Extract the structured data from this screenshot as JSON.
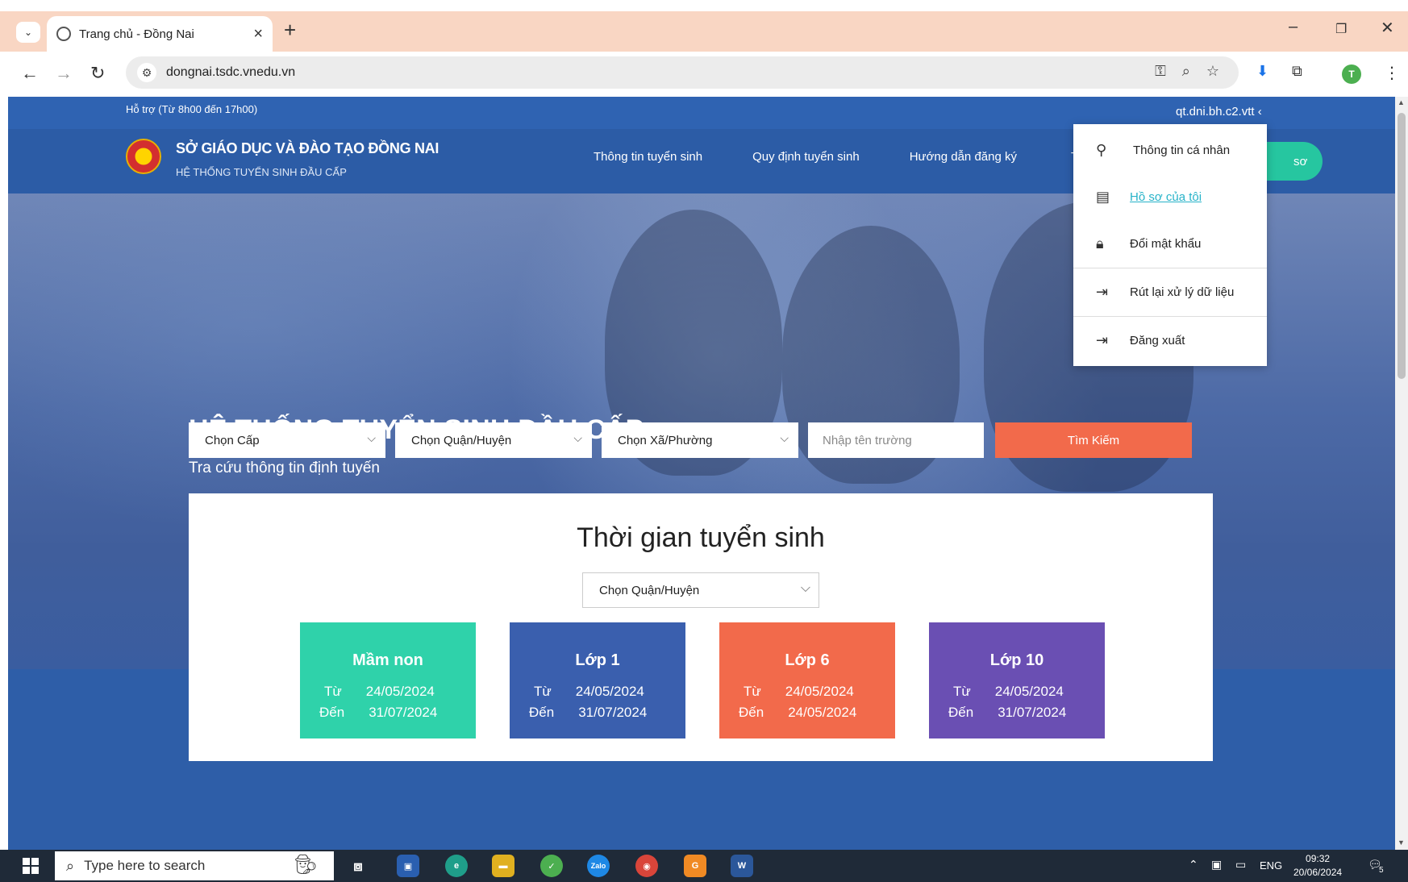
{
  "browser": {
    "tab_title": "Trang chủ - Đồng Nai",
    "new_tab": "+",
    "url": "dongnai.tsdc.vnedu.vn",
    "profile_initial": "T"
  },
  "topbar": {
    "support": "Hỗ trợ (Từ 8h00 đến 17h00)",
    "user": "qt.dni.bh.c2.vtt"
  },
  "header": {
    "org_title": "SỞ GIÁO DỤC VÀ ĐÀO TẠO ĐỒNG NAI",
    "org_sub": "HỆ THỐNG TUYỂN SINH ĐẦU CẤP",
    "nav": [
      "Thông tin tuyển sinh",
      "Quy định tuyển sinh",
      "Hướng dẫn đăng ký"
    ],
    "nav_cut": "T",
    "register_fragment": "sơ"
  },
  "hero": {
    "title": "HỆ THỐNG TUYỂN SINH ĐẦU CẤP",
    "subtitle": "Tra cứu thông tin định tuyến",
    "select_level": "Chọn Cấp",
    "select_district": "Chọn Quận/Huyện",
    "select_ward": "Chọn Xã/Phường",
    "school_placeholder": "Nhập tên trường",
    "search_button": "Tìm Kiếm"
  },
  "schedule": {
    "title": "Thời gian tuyển sinh",
    "district_select": "Chọn Quận/Huyện",
    "from_label": "Từ",
    "to_label": "Đến",
    "tiles": [
      {
        "name": "Mầm non",
        "from": "24/05/2024",
        "to": "31/07/2024",
        "color": "#2fd2aa"
      },
      {
        "name": "Lớp 1",
        "from": "24/05/2024",
        "to": "31/07/2024",
        "color": "#3a5fae"
      },
      {
        "name": "Lớp 6",
        "from": "24/05/2024",
        "to": "24/05/2024",
        "color": "#f26a4b"
      },
      {
        "name": "Lớp 10",
        "from": "24/05/2024",
        "to": "31/07/2024",
        "color": "#6a4fb3"
      }
    ]
  },
  "user_menu": {
    "items": [
      "Thông tin cá nhân",
      "Hồ sơ của tôi",
      "Đổi mật khẩu",
      "Rút lại xử lý dữ liệu",
      "Đăng xuất"
    ]
  },
  "taskbar": {
    "search_placeholder": "Type here to search",
    "language": "ENG",
    "time": "09:32",
    "date": "20/06/2024",
    "notifications": "5"
  }
}
